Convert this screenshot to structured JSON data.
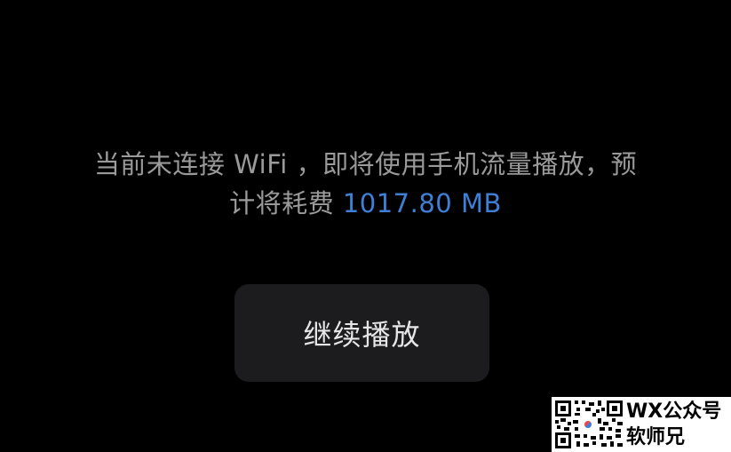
{
  "notice": {
    "line1": "当前未连接 WiFi ，即将使用手机流量播放，预",
    "line2_prefix": "计将耗费 ",
    "data_size": "1017.80 MB"
  },
  "button": {
    "continue_label": "继续播放"
  },
  "watermark": {
    "line1": "WX公众号",
    "line2": "软师兄"
  },
  "colors": {
    "background": "#000000",
    "notice_text": "#9a9a9a",
    "highlight": "#3f7fd6",
    "button_bg": "#1c1c1e",
    "button_text": "#e6e6e6"
  }
}
